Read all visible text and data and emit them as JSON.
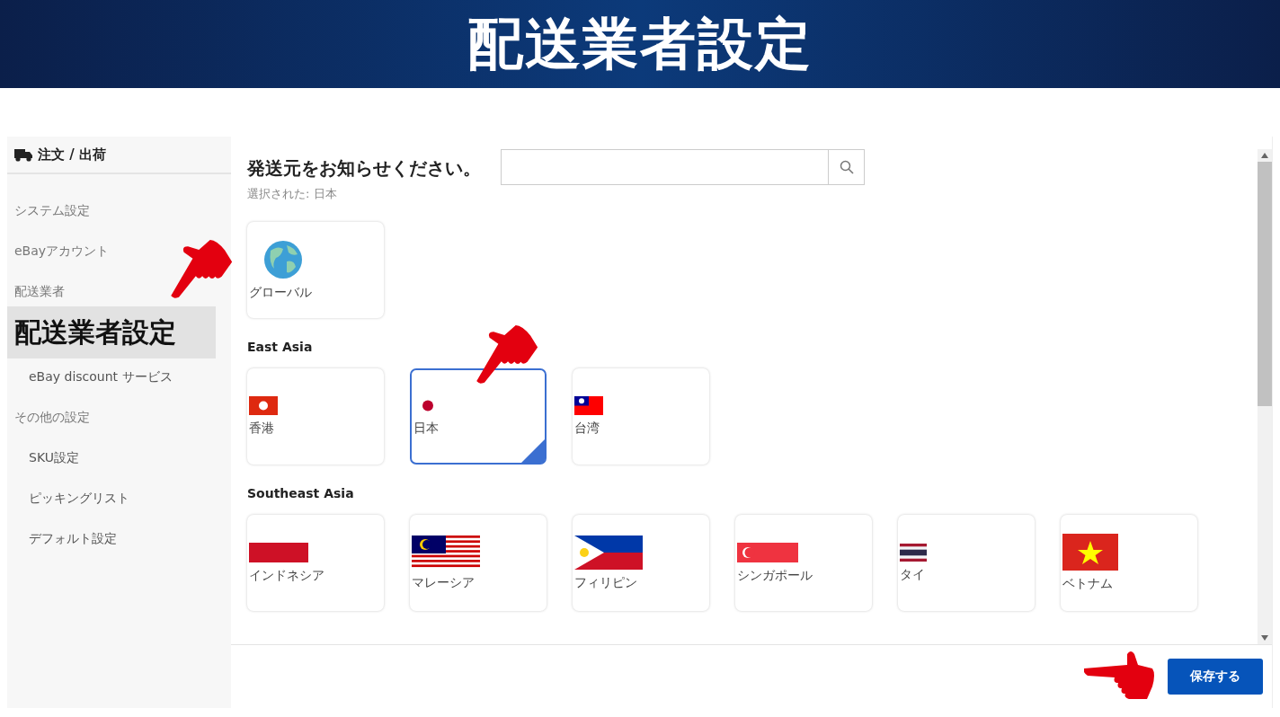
{
  "banner": {
    "title": "配送業者設定"
  },
  "sidebar": {
    "header": "注文 / 出荷",
    "items": [
      {
        "label": "システム設定",
        "selected": false
      },
      {
        "label": "eBayアカウント",
        "selected": false
      },
      {
        "label": "配送業者",
        "selected": false,
        "children": [
          {
            "label": "配送業者設定",
            "selected": true
          },
          {
            "label": "eBay discount サービス",
            "selected": false
          }
        ]
      },
      {
        "label": "その他の設定",
        "selected": false,
        "children": [
          {
            "label": "SKU設定",
            "selected": false
          },
          {
            "label": "ピッキングリスト",
            "selected": false
          },
          {
            "label": "デフォルト設定",
            "selected": false
          }
        ]
      }
    ]
  },
  "main": {
    "title": "発送元をお知らせください。",
    "selected_text": "選択された: 日本",
    "groups": [
      {
        "cards": [
          {
            "label": "グローバル",
            "kind": "globe",
            "selected": false
          }
        ]
      },
      {
        "heading": "East Asia",
        "cards": [
          {
            "label": "香港",
            "kind": "hk",
            "selected": false
          },
          {
            "label": "日本",
            "kind": "jp",
            "selected": true
          },
          {
            "label": "台湾",
            "kind": "tw",
            "selected": false
          }
        ]
      },
      {
        "heading": "Southeast Asia",
        "cards": [
          {
            "label": "インドネシア",
            "kind": "id",
            "selected": false
          },
          {
            "label": "マレーシア",
            "kind": "my",
            "selected": false
          },
          {
            "label": "フィリピン",
            "kind": "ph",
            "selected": false
          },
          {
            "label": "シンガポール",
            "kind": "sg",
            "selected": false
          },
          {
            "label": "タイ",
            "kind": "th",
            "selected": false
          },
          {
            "label": "ベトナム",
            "kind": "vn",
            "selected": false
          }
        ]
      }
    ]
  },
  "footer": {
    "save": "保存する"
  }
}
